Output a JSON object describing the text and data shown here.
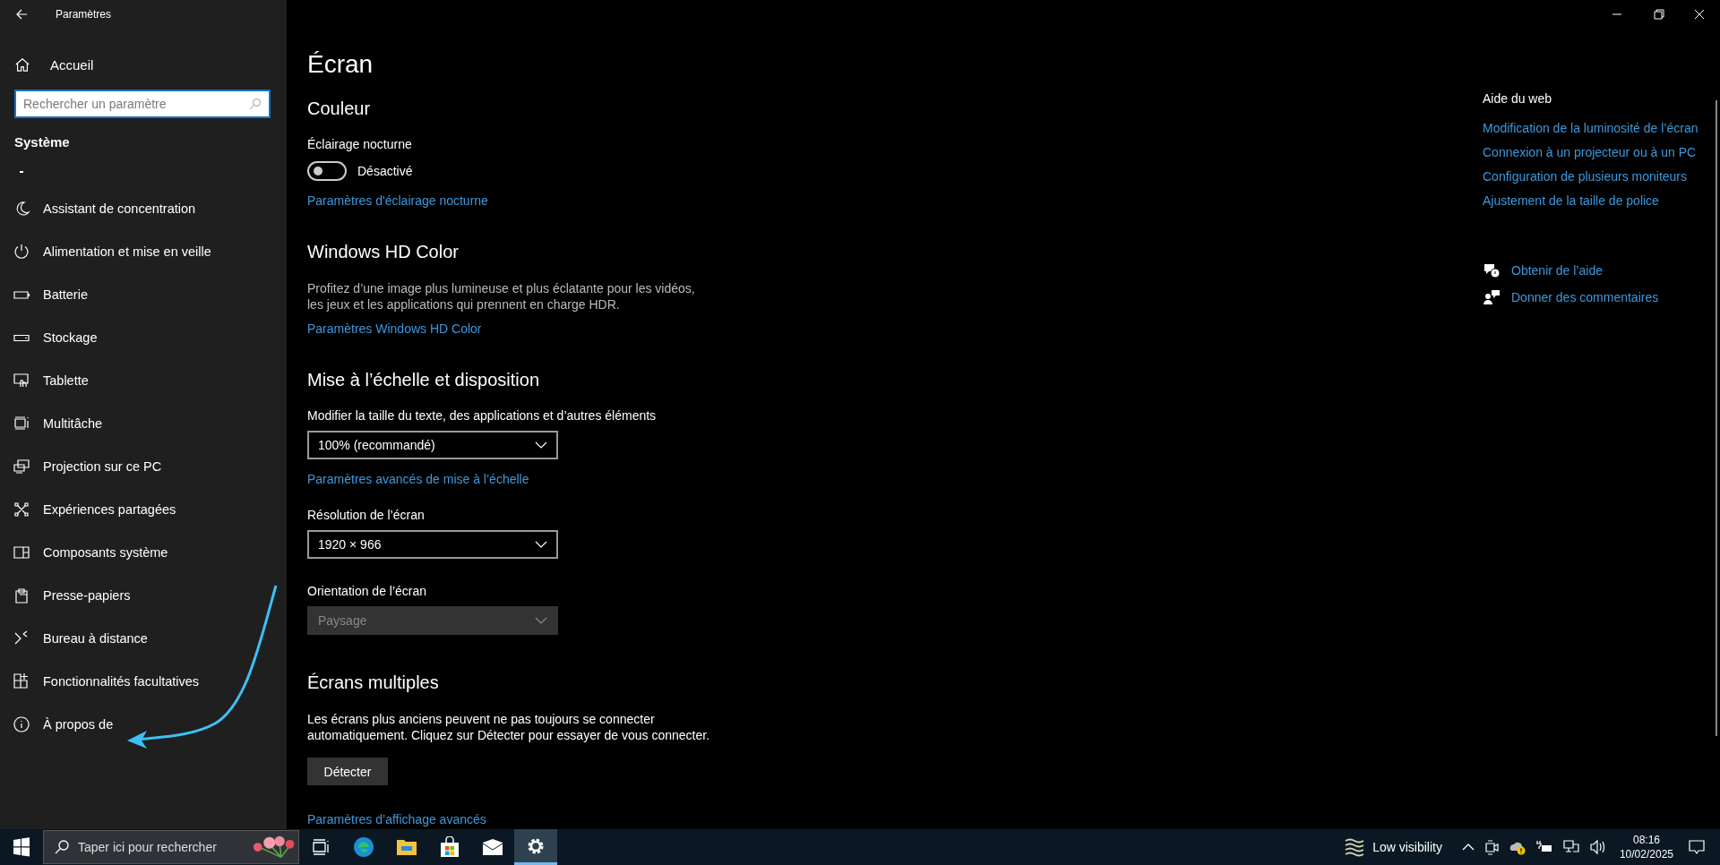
{
  "window": {
    "title": "Paramètres"
  },
  "sidebar": {
    "home": "Accueil",
    "search": {
      "placeholder": "Rechercher un paramètre"
    },
    "section": "Système",
    "items": [
      {
        "label": "Assistant de concentration",
        "selected": false
      },
      {
        "label": "Alimentation et mise en veille",
        "selected": false
      },
      {
        "label": "Batterie",
        "selected": false
      },
      {
        "label": "Stockage",
        "selected": false
      },
      {
        "label": "Tablette",
        "selected": false
      },
      {
        "label": "Multitâche",
        "selected": false
      },
      {
        "label": "Projection sur ce PC",
        "selected": false
      },
      {
        "label": "Expériences partagées",
        "selected": false
      },
      {
        "label": "Composants système",
        "selected": false
      },
      {
        "label": "Presse-papiers",
        "selected": false
      },
      {
        "label": "Bureau à distance",
        "selected": false
      },
      {
        "label": "Fonctionnalités facultatives",
        "selected": false
      },
      {
        "label": "À propos de",
        "selected": false
      }
    ]
  },
  "page": {
    "title": "Écran",
    "sections": [
      {
        "heading": "Couleur",
        "items": [
          {
            "kind": "label",
            "text": "Éclairage nocturne"
          },
          {
            "kind": "toggle",
            "on": false,
            "text": "Désactivé"
          },
          {
            "kind": "link",
            "text": "Paramètres d'éclairage nocturne"
          }
        ]
      },
      {
        "heading": "Windows HD Color",
        "items": [
          {
            "kind": "paragraph",
            "text": "Profitez d’une image plus lumineuse et plus éclatante pour les vidéos, les jeux et les applications qui prennent en charge HDR."
          },
          {
            "kind": "link",
            "text": "Paramètres Windows HD Color"
          }
        ]
      },
      {
        "heading": "Mise à l’échelle et disposition",
        "items": [
          {
            "kind": "label",
            "text": "Modifier la taille du texte, des applications et d’autres éléments"
          },
          {
            "kind": "dropdown",
            "value": "100% (recommandé)",
            "disabled": false
          },
          {
            "kind": "link",
            "text": "Paramètres avancés de mise à l’échelle"
          },
          {
            "kind": "label",
            "text": "Résolution de l’écran"
          },
          {
            "kind": "dropdown",
            "value": "1920 × 966",
            "disabled": false
          },
          {
            "kind": "label",
            "text": "Orientation de l’écran"
          },
          {
            "kind": "dropdown",
            "value": "Paysage",
            "disabled": true
          }
        ]
      },
      {
        "heading": "Écrans multiples",
        "items": [
          {
            "kind": "paragraph",
            "text": "Les écrans plus anciens peuvent ne pas toujours se connecter automatiquement. Cliquez sur Détecter pour essayer de vous connecter."
          },
          {
            "kind": "button",
            "text": "Détecter"
          },
          {
            "kind": "link",
            "text": "Paramètres d’affichage avancés"
          }
        ]
      }
    ]
  },
  "help": {
    "title": "Aide du web",
    "links": [
      "Modification de la luminosité de l’écran",
      "Connexion à un projecteur ou à un PC",
      "Configuration de plusieurs moniteurs",
      "Ajustement de la taille de police"
    ],
    "actions": [
      "Obtenir de l’aide",
      "Donner des commentaires"
    ]
  },
  "taskbar": {
    "search": {
      "placeholder": "Taper ici pour rechercher"
    },
    "apps": [
      {
        "selected": false
      },
      {
        "selected": false
      },
      {
        "selected": false
      },
      {
        "selected": false
      },
      {
        "selected": false
      },
      {
        "selected": true
      }
    ],
    "weather": "Low visibility",
    "time": "08:16",
    "date": "10/02/2025"
  }
}
